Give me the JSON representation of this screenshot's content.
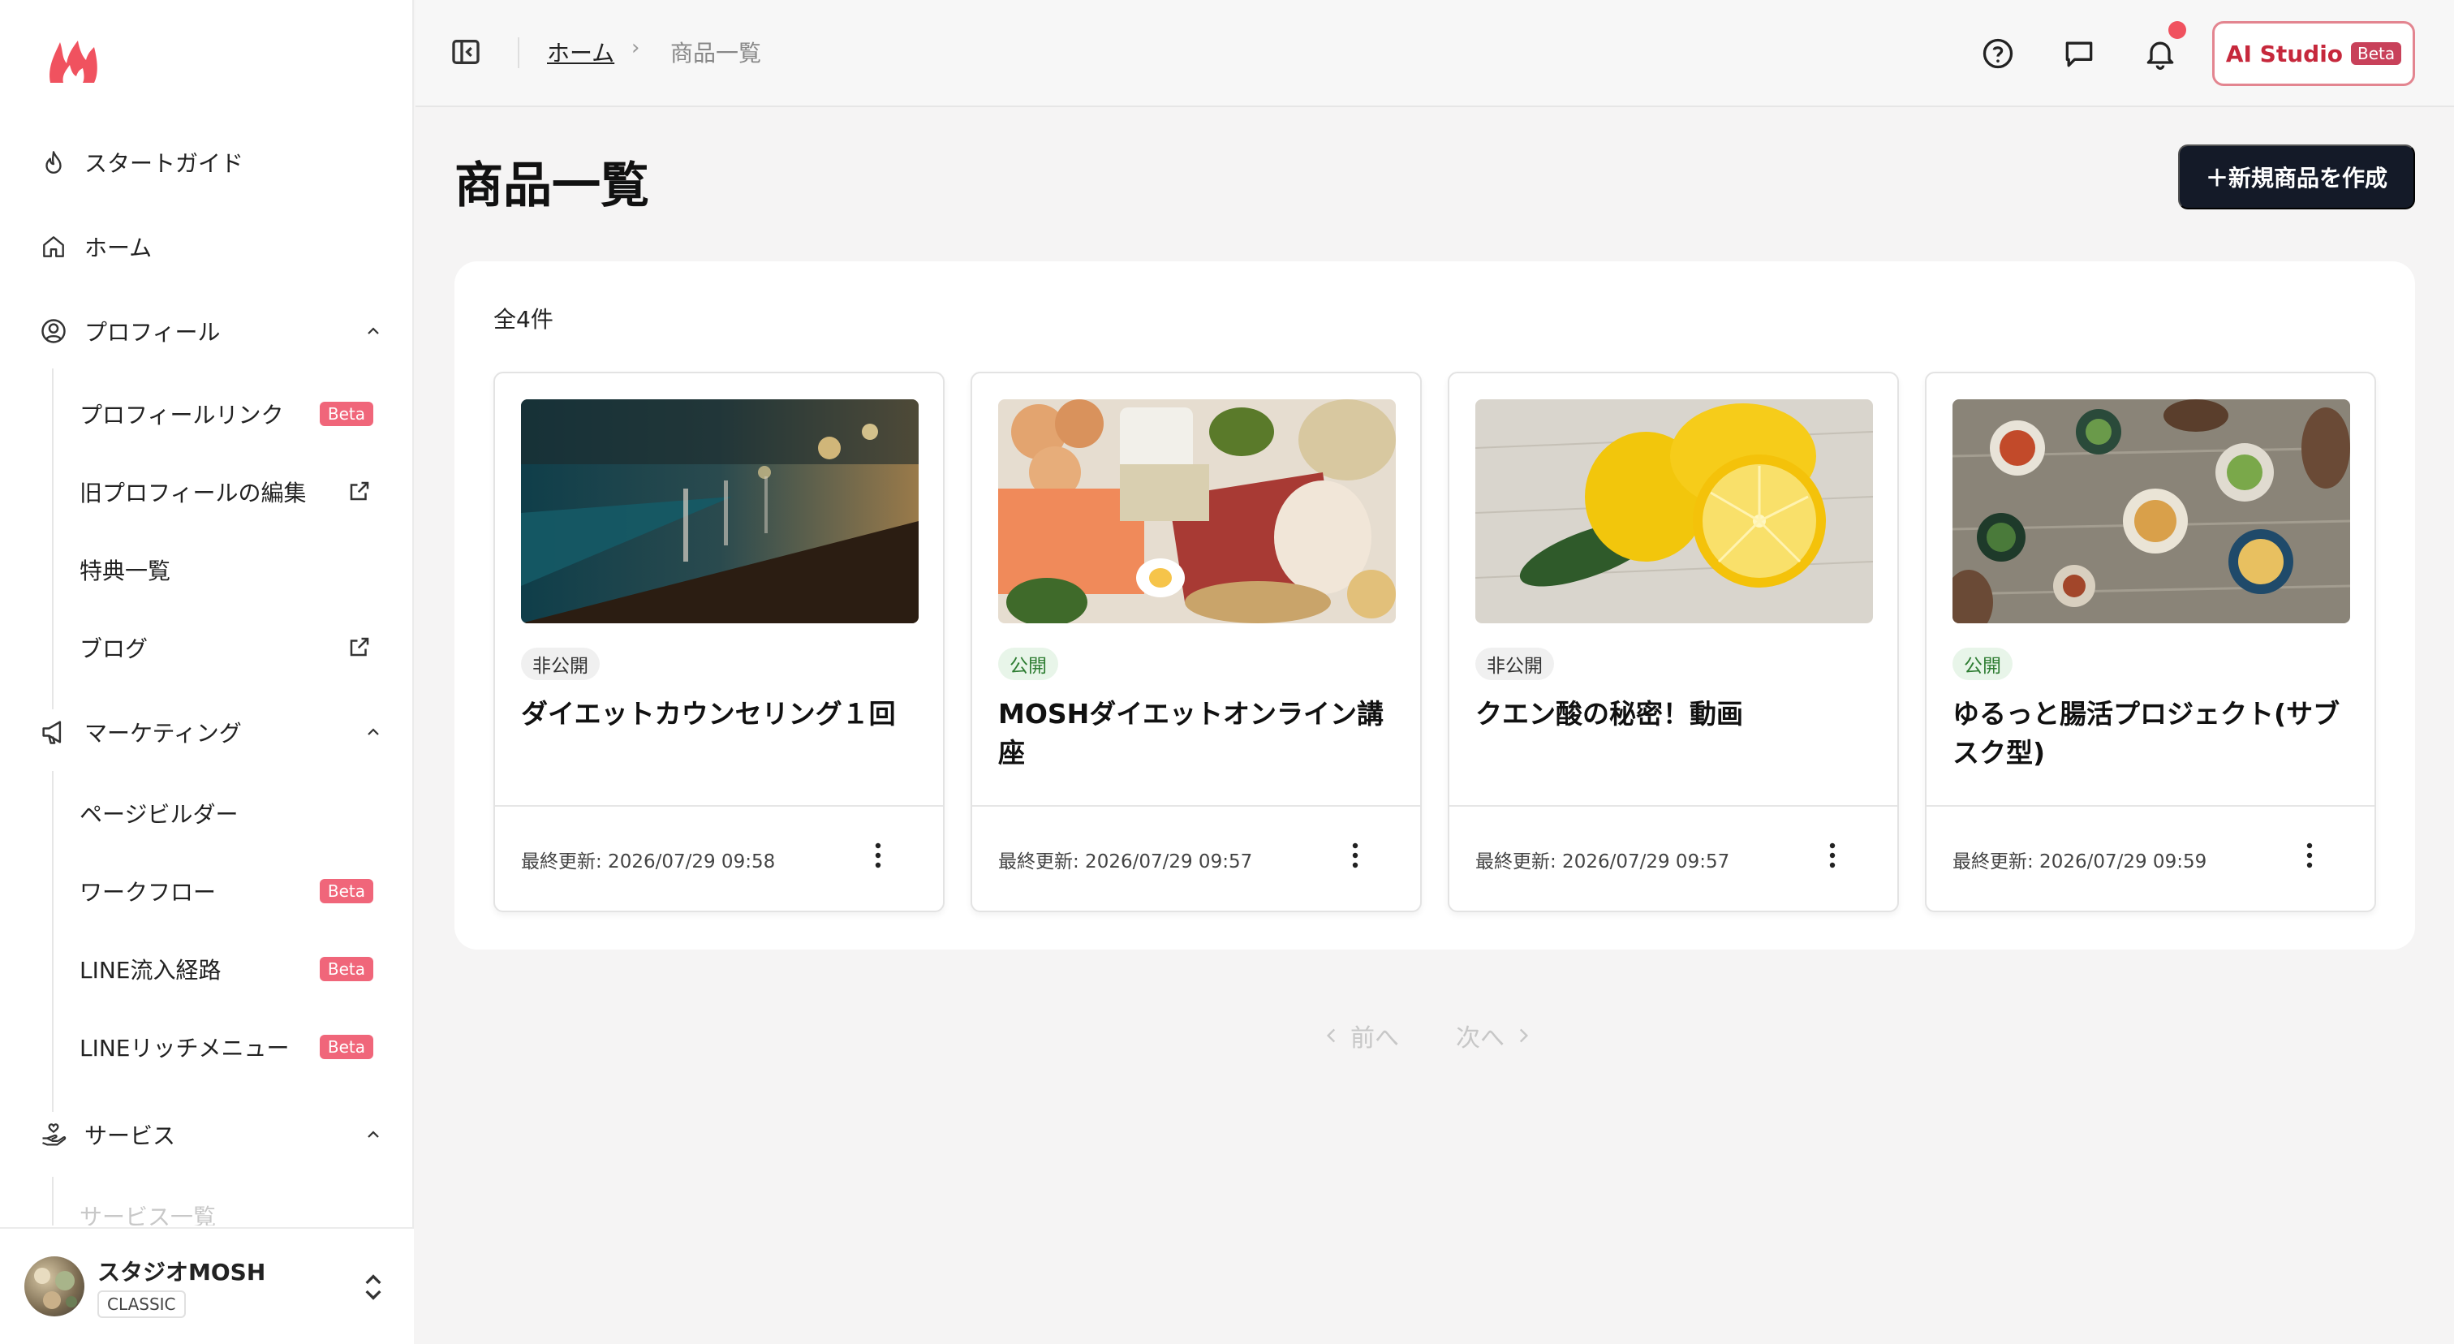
{
  "breadcrumb": {
    "home": "ホーム",
    "separator": "›",
    "current": "商品一覧"
  },
  "header": {
    "ai_studio": "AI Studio",
    "ai_studio_badge": "Beta"
  },
  "sidebar": {
    "items": [
      {
        "label": "スタートガイド",
        "icon": "flame-outline-icon"
      },
      {
        "label": "ホーム",
        "icon": "home-icon"
      },
      {
        "label": "プロフィール",
        "icon": "user-circle-icon"
      },
      {
        "label": "マーケティング",
        "icon": "megaphone-icon"
      },
      {
        "label": "サービス",
        "icon": "hand-heart-icon"
      }
    ],
    "profile_sub": [
      {
        "label": "プロフィールリンク",
        "badge": "Beta"
      },
      {
        "label": "旧プロフィールの編集"
      },
      {
        "label": "特典一覧"
      },
      {
        "label": "ブログ"
      }
    ],
    "marketing_sub": [
      {
        "label": "ページビルダー"
      },
      {
        "label": "ワークフロー",
        "badge": "Beta"
      },
      {
        "label": "LINE流入経路",
        "badge": "Beta"
      },
      {
        "label": "LINEリッチメニュー",
        "badge": "Beta"
      }
    ],
    "service_sub": [
      {
        "label": "サービス一覧"
      }
    ]
  },
  "account": {
    "name": "スタジオMOSH",
    "plan": "CLASSIC"
  },
  "main": {
    "title": "商品一覧",
    "create_button": "＋新規商品を作成",
    "count": "全4件",
    "products": [
      {
        "status": "非公開",
        "name": "ダイエットカウンセリング１回",
        "updated": "最終更新: 2026/07/29 09:58"
      },
      {
        "status": "公開",
        "name": "MOSHダイエットオンライン講座",
        "updated": "最終更新: 2026/07/29 09:57"
      },
      {
        "status": "非公開",
        "name": "クエン酸の秘密！動画",
        "updated": "最終更新: 2026/07/29 09:57"
      },
      {
        "status": "公開",
        "name": "ゆるっと腸活プロジェクト(サブスク型)",
        "updated": "最終更新: 2026/07/29 09:59"
      }
    ],
    "pagination": {
      "prev": "前へ",
      "next": "次へ"
    }
  },
  "colors": {
    "accent": "#f0525f",
    "beta": "#f0667a",
    "primary_button": "#141a28",
    "public_badge": "#2e7d32"
  }
}
